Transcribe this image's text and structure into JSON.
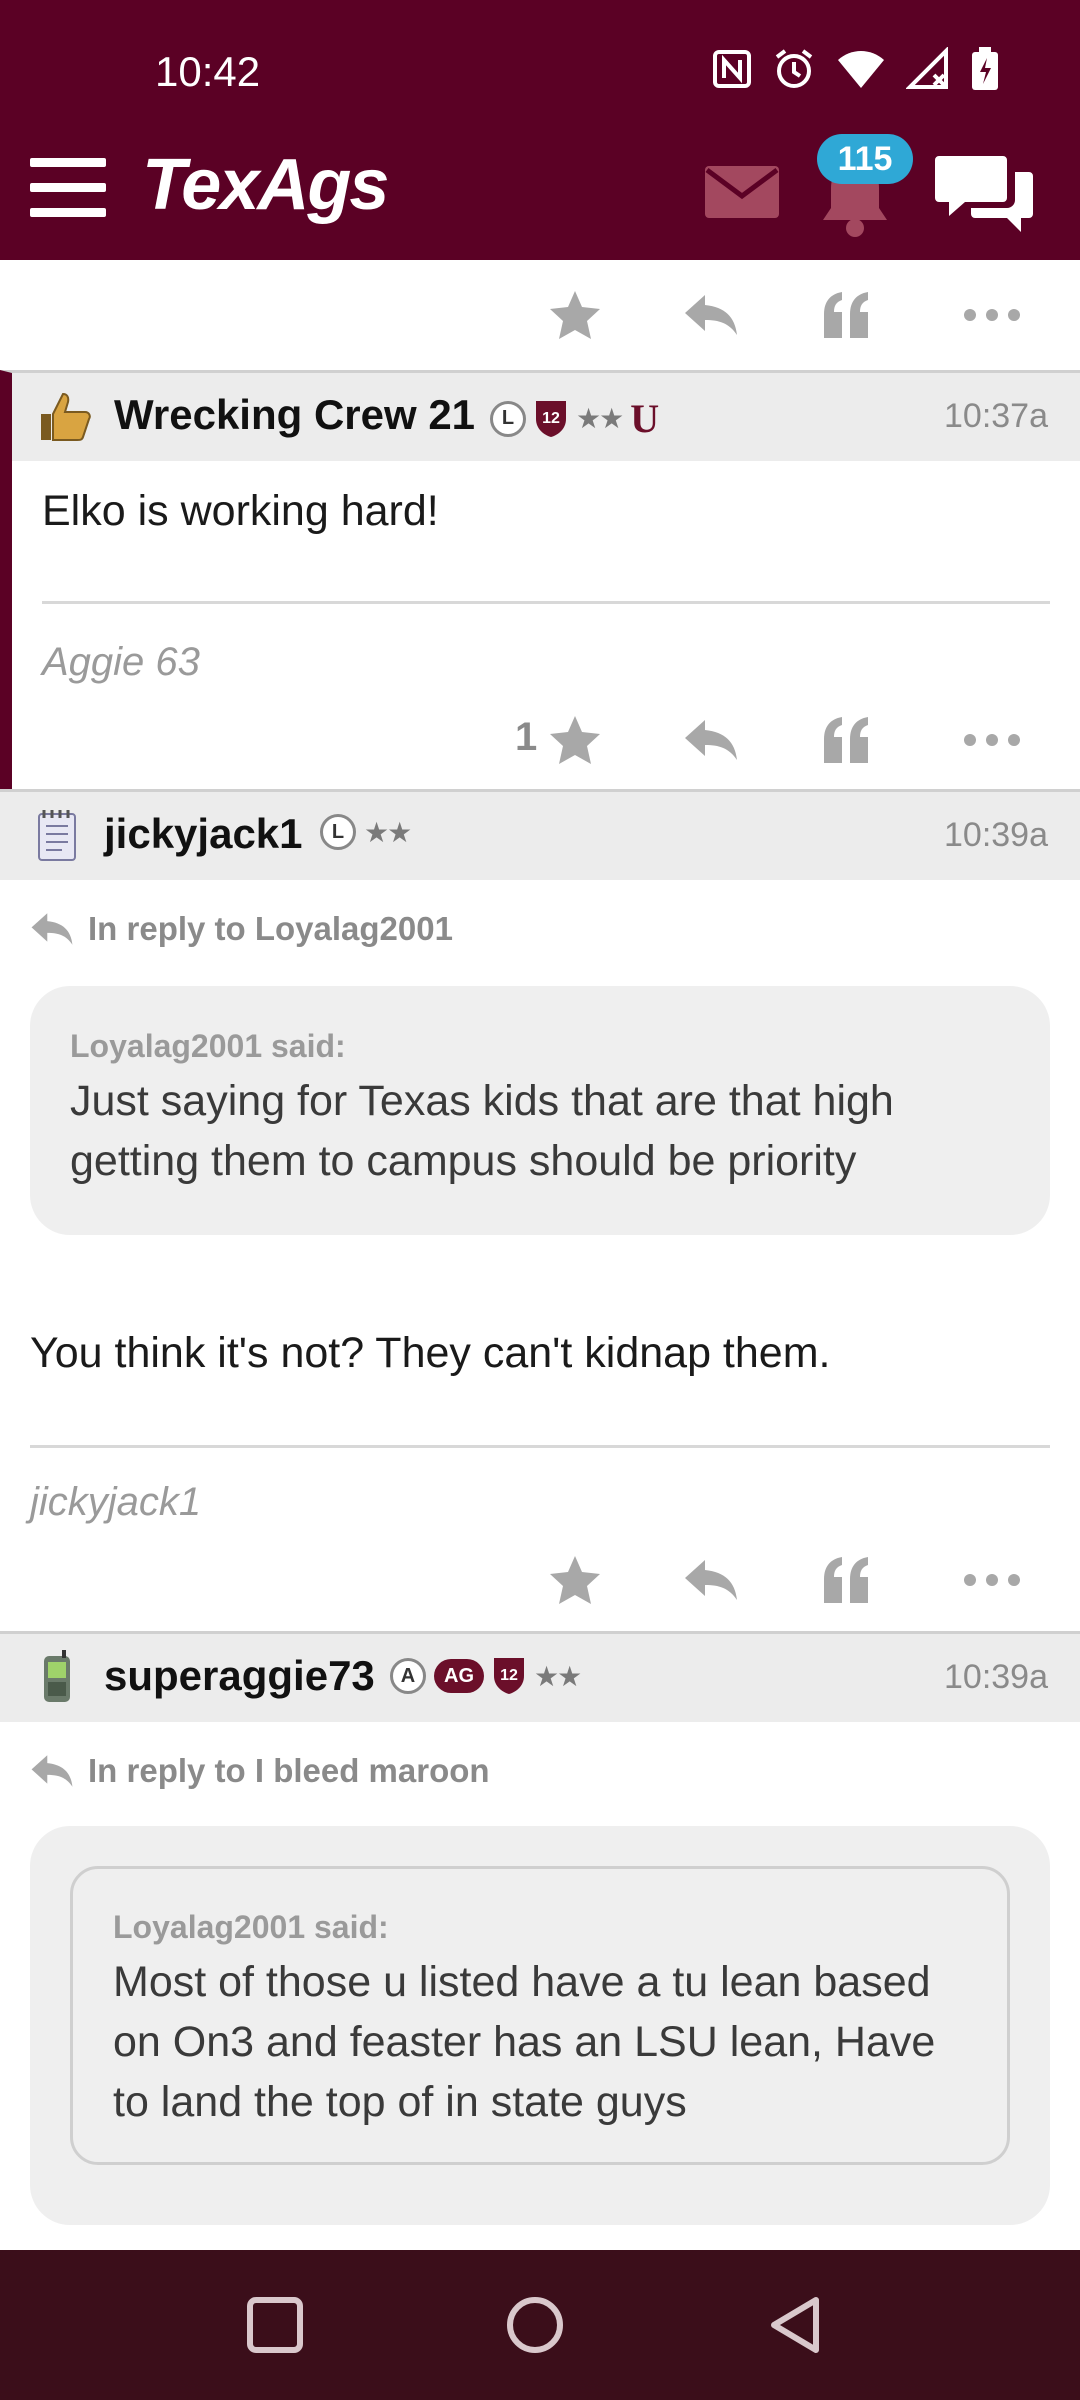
{
  "status_bar": {
    "time": "10:42"
  },
  "header": {
    "logo": "TexAgs",
    "notification_count": "115",
    "colors": {
      "header_bg": "#5b0125",
      "badge_bg": "#2fa8d6",
      "nav_bg": "#3b0e1a"
    }
  },
  "posts": [
    {
      "username": "Wrecking Crew 21",
      "badges": [
        "L",
        "12",
        "★★",
        "U"
      ],
      "time": "10:37a",
      "body": "Elko is working hard!",
      "signature": "Aggie 63",
      "star_count": "1"
    },
    {
      "username": "jickyjack1",
      "badges": [
        "L",
        "★★"
      ],
      "time": "10:39a",
      "reply_to": "In reply to Loyalag2001",
      "quote_attr": "Loyalag2001 said:",
      "quote_text": "Just saying for Texas kids that are that high getting them to campus should be priority",
      "body": "You think it's not? They can't kidnap them.",
      "signature": "jickyjack1"
    },
    {
      "username": "superaggie73",
      "badges": [
        "A",
        "AG",
        "12",
        "★★"
      ],
      "time": "10:39a",
      "reply_to": "In reply to I bleed maroon",
      "quote_attr": "Loyalag2001 said:",
      "quote_text": "Most of those u listed have a tu lean based on On3 and feaster has an LSU lean, Have to land the top of in state guys"
    }
  ]
}
